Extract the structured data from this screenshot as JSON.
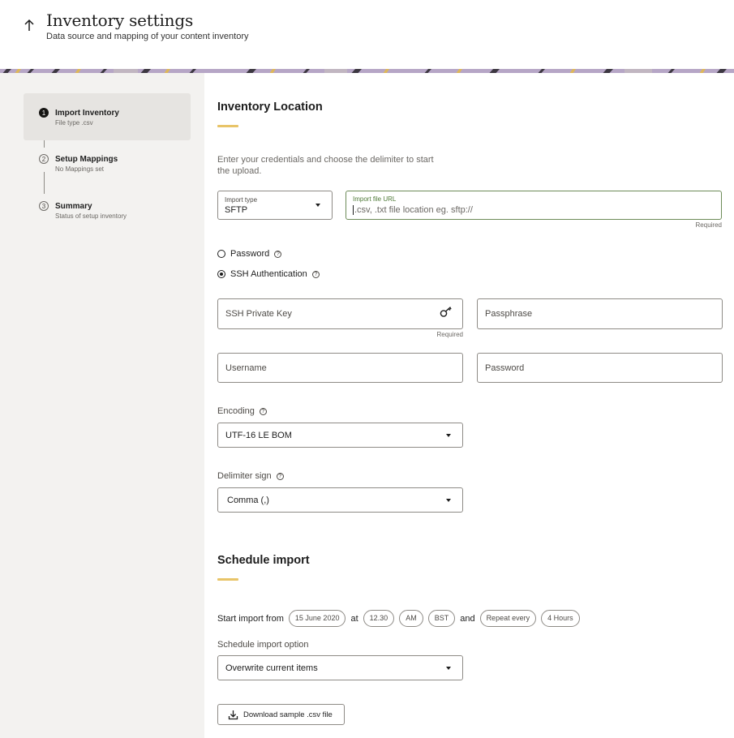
{
  "header": {
    "title": "Inventory settings",
    "subtitle": "Data source and mapping of your content inventory"
  },
  "steps": [
    {
      "number": "1",
      "label": "Import Inventory",
      "sub": "File type .csv",
      "active": true
    },
    {
      "number": "2",
      "label": "Setup Mappings",
      "sub": "No Mappings set",
      "active": false
    },
    {
      "number": "3",
      "label": "Summary",
      "sub": "Status of setup inventory",
      "active": false
    }
  ],
  "location": {
    "title": "Inventory Location",
    "description": "Enter your credentials and choose the delimiter to start the upload.",
    "import_type": {
      "label": "Import type",
      "value": "SFTP"
    },
    "url": {
      "label": "Import file URL",
      "placeholder": ".csv, .txt file location eg. sftp://",
      "required": "Required"
    },
    "auth": [
      {
        "label": "Password",
        "selected": false
      },
      {
        "label": "SSH Authentication",
        "selected": true
      }
    ],
    "ssh_key": {
      "placeholder": "SSH Private Key",
      "required": "Required"
    },
    "passphrase": {
      "placeholder": "Passphrase"
    },
    "username": {
      "placeholder": "Username"
    },
    "password": {
      "placeholder": "Password"
    },
    "encoding": {
      "label": "Encoding",
      "value": "UTF-16 LE BOM"
    },
    "delimiter": {
      "label": "Delimiter sign",
      "value": "Comma (,)"
    }
  },
  "schedule": {
    "title": "Schedule import",
    "start_label": "Start import from",
    "date": "15 June 2020",
    "at": "at",
    "time": "12.30",
    "ampm": "AM",
    "tz": "BST",
    "and": "and",
    "repeat": "Repeat every",
    "interval": "4 Hours",
    "option_label": "Schedule import option",
    "option_value": "Overwrite current items",
    "download_label": "Download sample .csv file"
  },
  "colors": {
    "accent": "#e8c468",
    "sidebar": "#f3f2f0",
    "active_step": "#e6e4e1",
    "url_border": "#6d8b58"
  },
  "icons": {
    "help": "question-circle-icon",
    "key": "key-icon",
    "download": "download-icon",
    "back": "arrow-up-icon"
  }
}
